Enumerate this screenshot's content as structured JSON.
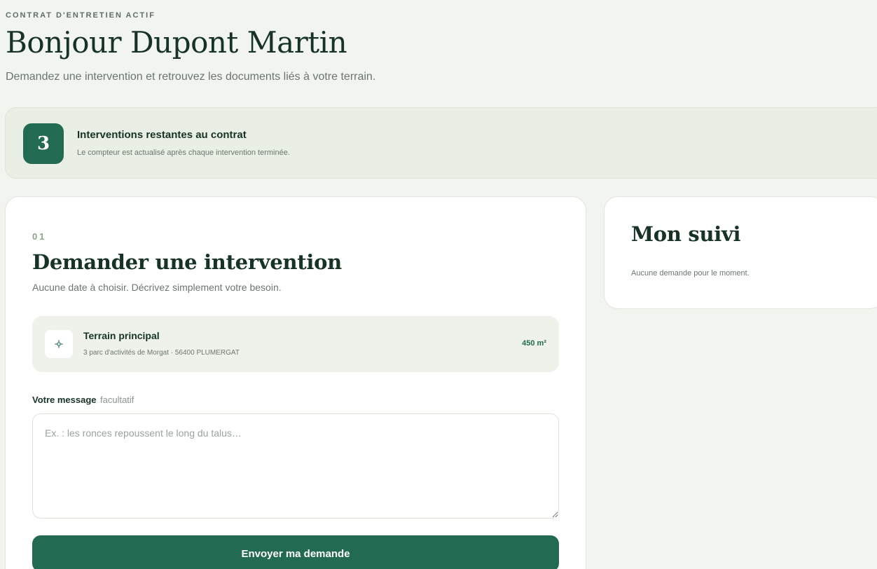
{
  "header": {
    "eyebrow": "CONTRAT D'ENTRETIEN ACTIF",
    "greeting": "Bonjour Dupont Martin",
    "lead": "Demandez une intervention et retrouvez les documents liés à votre terrain."
  },
  "counter": {
    "value": "3",
    "title": "Interventions restantes au contrat",
    "subtitle": "Le compteur est actualisé après chaque intervention terminée."
  },
  "request": {
    "step": "01",
    "title": "Demander une intervention",
    "subtitle": "Aucune date à choisir. Décrivez simplement votre besoin.",
    "terrain": {
      "icon": "location-target-icon",
      "name": "Terrain principal",
      "address": "3 parc d'activités de Morgat · 56400 PLUMERGAT",
      "area": "450 m²"
    },
    "message": {
      "label": "Votre message",
      "optional": "facultatif",
      "placeholder": "Ex. : les ronces repoussent le long du talus…",
      "value": ""
    },
    "submit_label": "Envoyer ma demande"
  },
  "tracking": {
    "title": "Mon suivi",
    "empty": "Aucune demande pour le moment."
  },
  "colors": {
    "background": "#f2f4ef",
    "accent": "#226a52",
    "text": "#173326",
    "muted": "#6a766f"
  }
}
